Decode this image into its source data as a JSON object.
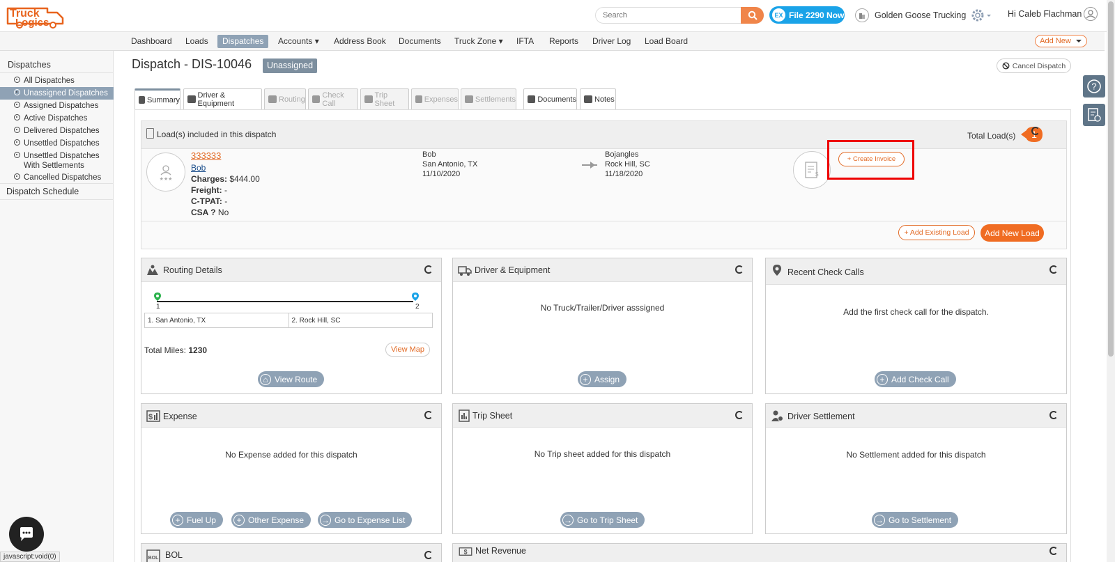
{
  "app": {
    "logo_text_1": "Truck",
    "logo_text_2": "Logics"
  },
  "header": {
    "search_placeholder": "Search",
    "file_button": "File 2290 Now",
    "file_badge": "EX",
    "company": "Golden Goose Trucking",
    "greeting": "Hi Caleb Flachman"
  },
  "nav": {
    "items": [
      "Dashboard",
      "Loads",
      "Dispatches",
      "Accounts ▾",
      "Address Book",
      "Documents",
      "Truck Zone ▾",
      "IFTA",
      "Reports",
      "Driver Log",
      "Load Board"
    ],
    "active": "Dispatches",
    "add_new": "Add New"
  },
  "sidebar": {
    "heading": "Dispatches",
    "items": [
      "All Dispatches",
      "Unassigned Dispatches",
      "Assigned Dispatches",
      "Active Dispatches",
      "Delivered Dispatches",
      "Unsettled Dispatches",
      "Unsettled Dispatches With Settlements",
      "Cancelled Dispatches"
    ],
    "active": "Unassigned Dispatches",
    "schedule": "Dispatch Schedule"
  },
  "page": {
    "title": "Dispatch - DIS-10046",
    "status": "Unassigned",
    "cancel": "Cancel Dispatch"
  },
  "tabs": [
    {
      "label": "Summary",
      "state": "active"
    },
    {
      "label": "Driver & Equipment",
      "state": "enabled"
    },
    {
      "label": "Routing",
      "state": "disabled"
    },
    {
      "label": "Check Call",
      "state": "disabled"
    },
    {
      "label": "Trip Sheet",
      "state": "disabled"
    },
    {
      "label": "Expenses",
      "state": "disabled"
    },
    {
      "label": "Settlements",
      "state": "disabled"
    },
    {
      "label": "Documents",
      "state": "enabled"
    },
    {
      "label": "Notes",
      "state": "enabled"
    }
  ],
  "loads": {
    "title": "Load(s) included in this dispatch",
    "total_label": "Total Load(s)",
    "total_count": "1",
    "load_id": "333333",
    "driver": "Bob",
    "charges_label": "Charges:",
    "charges": "$444.00",
    "freight_label": "Freight:",
    "freight": "-",
    "ctpat_label": "C-TPAT:",
    "ctpat": "-",
    "csa_label": "CSA ?",
    "csa": "No",
    "origin_name": "Bob",
    "origin_city": "San Antonio, TX",
    "origin_date": "11/10/2020",
    "dest_name": "Bojangles",
    "dest_city": "Rock Hill, SC",
    "dest_date": "11/18/2020",
    "create_invoice": "+ Create Invoice",
    "add_existing": "+ Add Existing Load",
    "add_new": "Add New Load"
  },
  "routing": {
    "title": "Routing Details",
    "stop1_num": "1",
    "stop2_num": "2",
    "stop1": "1. San Antonio, TX",
    "stop2": "2. Rock Hill, SC",
    "miles_label": "Total Miles:",
    "miles": "1230",
    "view_map": "View Map",
    "view_route": "View Route"
  },
  "driver_equipment": {
    "title": "Driver & Equipment",
    "message": "No Truck/Trailer/Driver asssigned",
    "button": "Assign"
  },
  "check_calls": {
    "title": "Recent Check Calls",
    "message": "Add the first check call for the dispatch.",
    "button": "Add Check Call"
  },
  "expense": {
    "title": "Expense",
    "message": "No Expense added for this dispatch",
    "btn1": "Fuel Up",
    "btn2": "Other Expense",
    "btn3": "Go to Expense List"
  },
  "trip_sheet": {
    "title": "Trip Sheet",
    "message": "No Trip sheet added for this dispatch",
    "button": "Go to Trip Sheet"
  },
  "settlement": {
    "title": "Driver Settlement",
    "message": "No Settlement added for this dispatch",
    "button": "Go to Settlement"
  },
  "bol": {
    "title": "BOL",
    "icon_text": "BOL"
  },
  "net_revenue": {
    "title": "Net Revenue"
  },
  "statusbar": "javascript:void(0)",
  "colors": {
    "accent": "#f06c22",
    "nav_active": "#8fa2b5",
    "highlight": "#e00000",
    "link_blue": "#1aa3e8"
  }
}
